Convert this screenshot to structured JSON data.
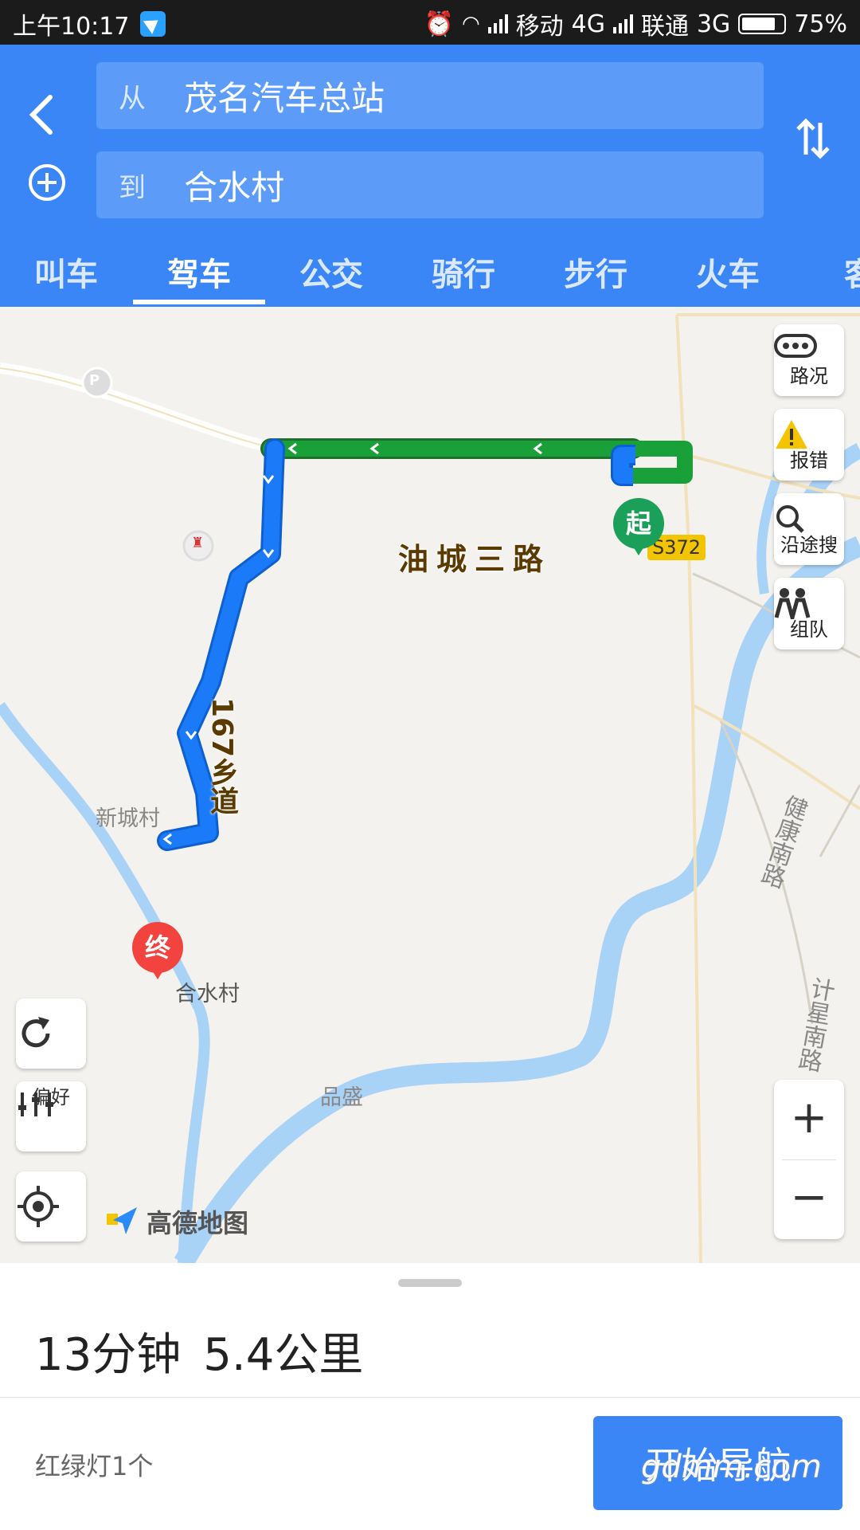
{
  "status_bar": {
    "time": "上午10:17",
    "carrier1": "移动",
    "net1": "4G",
    "carrier2": "联通",
    "net2": "3G",
    "battery": "75%"
  },
  "search": {
    "from_prefix": "从",
    "from_value": "茂名汽车总站",
    "to_prefix": "到",
    "to_value": "合水村"
  },
  "tabs": [
    {
      "label": "叫车"
    },
    {
      "label": "驾车"
    },
    {
      "label": "公交"
    },
    {
      "label": "骑行"
    },
    {
      "label": "步行"
    },
    {
      "label": "火车"
    },
    {
      "label": "客"
    }
  ],
  "active_tab": "驾车",
  "map": {
    "road_main": "油城三路",
    "road_route": "167乡道",
    "road_badge": "S372",
    "village1": "新城村",
    "village2": "合水村",
    "area": "品盛",
    "road_east1": "健康南路",
    "road_east2": "计星南路",
    "start_marker": "起",
    "end_marker": "终",
    "logo_text": "高德地图"
  },
  "tools": {
    "traffic": "路况",
    "report": "报错",
    "search_along": "沿途搜",
    "team": "组队",
    "preference": "偏好"
  },
  "summary": {
    "duration": "13分钟",
    "distance": "5.4公里",
    "traffic_lights": "红绿灯1个",
    "nav_button": "开始导航"
  },
  "watermark": "gdmm.com",
  "colors": {
    "header_blue": "#3b86f6",
    "route_blue": "#1a7af8",
    "route_green": "#1aa038",
    "water": "#a9d2f7"
  }
}
